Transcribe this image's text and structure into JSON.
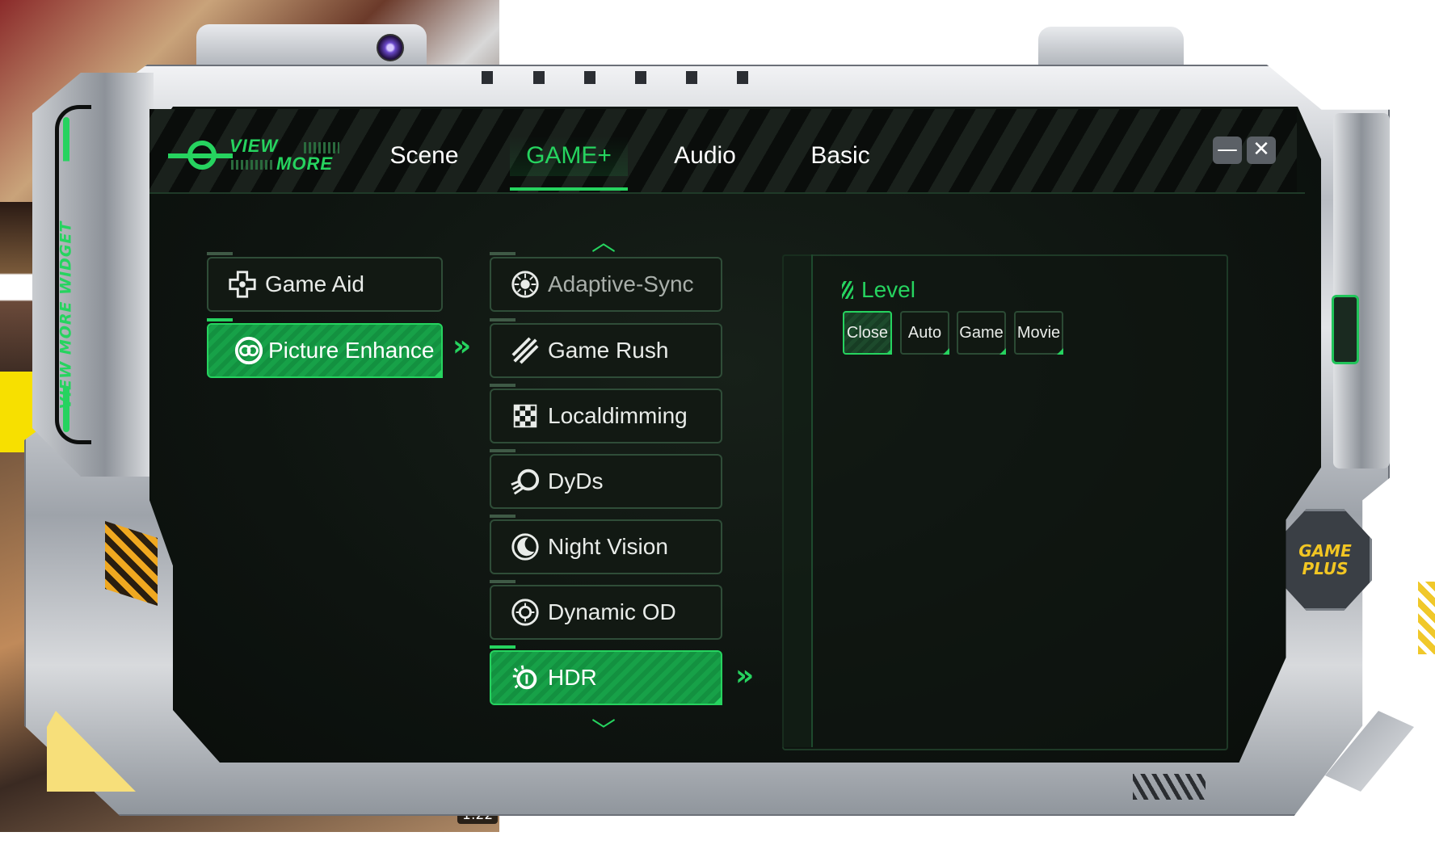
{
  "app": {
    "logo_line1": "VIEW",
    "logo_line2": "MORE",
    "side_label": "VIEW MORE WIDGET",
    "badge_line1": "GAME",
    "badge_line2": "PLUS"
  },
  "tabs": [
    {
      "label": "Scene",
      "active": false
    },
    {
      "label": "GAME+",
      "active": true
    },
    {
      "label": "Audio",
      "active": false
    },
    {
      "label": "Basic",
      "active": false
    }
  ],
  "window_controls": {
    "minimize": "—",
    "close": "✕"
  },
  "left_menu": [
    {
      "label": "Game Aid",
      "icon": "gamepad-icon",
      "active": false
    },
    {
      "label": "Picture Enhance",
      "icon": "picture-enhance-icon",
      "active": true
    }
  ],
  "feature_menu": [
    {
      "label": "Adaptive-Sync",
      "icon": "adaptive-sync-icon",
      "active": false,
      "dim": true
    },
    {
      "label": "Game Rush",
      "icon": "game-rush-icon",
      "active": false
    },
    {
      "label": "Localdimming",
      "icon": "localdimming-icon",
      "active": false
    },
    {
      "label": "DyDs",
      "icon": "dyds-icon",
      "active": false
    },
    {
      "label": "Night Vision",
      "icon": "night-vision-icon",
      "active": false
    },
    {
      "label": "Dynamic OD",
      "icon": "dynamic-od-icon",
      "active": false
    },
    {
      "label": "HDR",
      "icon": "hdr-icon",
      "active": true
    }
  ],
  "panel": {
    "title": "Level",
    "options": [
      {
        "label": "Close",
        "active": true
      },
      {
        "label": "Auto",
        "active": false
      },
      {
        "label": "Game",
        "active": false
      },
      {
        "label": "Movie",
        "active": false
      }
    ]
  },
  "background": {
    "video_time": "1:22"
  },
  "colors": {
    "accent": "#26d35f",
    "frame": "#b9bdc3",
    "screen": "#0e1410",
    "badge": "#f2c623"
  }
}
